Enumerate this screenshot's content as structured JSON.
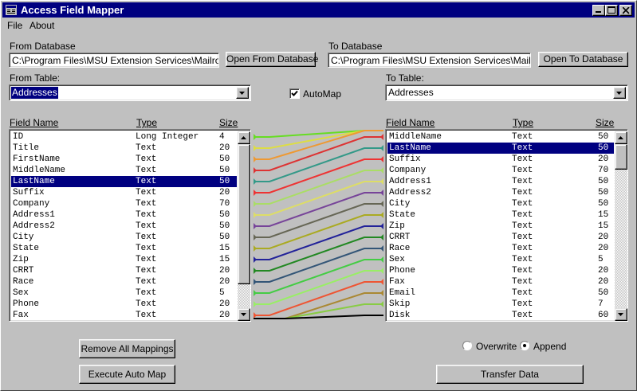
{
  "window": {
    "title": "Access Field Mapper"
  },
  "menu": [
    {
      "label": "File"
    },
    {
      "label": "About"
    }
  ],
  "from_db": {
    "label": "From Database",
    "path": "C:\\Program Files\\MSU Extension Services\\Mailroom\\",
    "button": "Open From Database"
  },
  "to_db": {
    "label": "To Database",
    "path": "C:\\Program Files\\MSU Extension Services\\Mailroom",
    "button": "Open To Database"
  },
  "from_table": {
    "label": "From Table:",
    "value": "Addresses"
  },
  "to_table": {
    "label": "To Table:",
    "value": "Addresses"
  },
  "automap": {
    "label": "AutoMap",
    "checked": true
  },
  "columns": {
    "name": "Field Name",
    "type": "Type",
    "size": "Size"
  },
  "from_fields": [
    {
      "name": "ID",
      "type": "Long Integer",
      "size": "4"
    },
    {
      "name": "Title",
      "type": "Text",
      "size": "20"
    },
    {
      "name": "FirstName",
      "type": "Text",
      "size": "50"
    },
    {
      "name": "MiddleName",
      "type": "Text",
      "size": "50"
    },
    {
      "name": "LastName",
      "type": "Text",
      "size": "50",
      "selected": true
    },
    {
      "name": "Suffix",
      "type": "Text",
      "size": "20"
    },
    {
      "name": "Company",
      "type": "Text",
      "size": "70"
    },
    {
      "name": "Address1",
      "type": "Text",
      "size": "50"
    },
    {
      "name": "Address2",
      "type": "Text",
      "size": "50"
    },
    {
      "name": "City",
      "type": "Text",
      "size": "50"
    },
    {
      "name": "State",
      "type": "Text",
      "size": "15"
    },
    {
      "name": "Zip",
      "type": "Text",
      "size": "15"
    },
    {
      "name": "CRRT",
      "type": "Text",
      "size": "20"
    },
    {
      "name": "Race",
      "type": "Text",
      "size": "20"
    },
    {
      "name": "Sex",
      "type": "Text",
      "size": "5"
    },
    {
      "name": "Phone",
      "type": "Text",
      "size": "20"
    },
    {
      "name": "Fax",
      "type": "Text",
      "size": "20"
    }
  ],
  "to_fields": [
    {
      "name": "MiddleName",
      "type": "Text",
      "size": "50"
    },
    {
      "name": "LastName",
      "type": "Text",
      "size": "50",
      "selected": true
    },
    {
      "name": "Suffix",
      "type": "Text",
      "size": "20"
    },
    {
      "name": "Company",
      "type": "Text",
      "size": "70"
    },
    {
      "name": "Address1",
      "type": "Text",
      "size": "50"
    },
    {
      "name": "Address2",
      "type": "Text",
      "size": "50"
    },
    {
      "name": "City",
      "type": "Text",
      "size": "50"
    },
    {
      "name": "State",
      "type": "Text",
      "size": "15"
    },
    {
      "name": "Zip",
      "type": "Text",
      "size": "15"
    },
    {
      "name": "CRRT",
      "type": "Text",
      "size": "20"
    },
    {
      "name": "Race",
      "type": "Text",
      "size": "20"
    },
    {
      "name": "Sex",
      "type": "Text",
      "size": "5"
    },
    {
      "name": "Phone",
      "type": "Text",
      "size": "20"
    },
    {
      "name": "Fax",
      "type": "Text",
      "size": "20"
    },
    {
      "name": "Email",
      "type": "Text",
      "size": "50"
    },
    {
      "name": "Skip",
      "type": "Text",
      "size": "7"
    },
    {
      "name": "Disk",
      "type": "Text",
      "size": "60"
    }
  ],
  "mappings": [
    {
      "from": 0,
      "to": -1,
      "color": "#66dd22"
    },
    {
      "from": 1,
      "to": -1,
      "color": "#dddd44"
    },
    {
      "from": 2,
      "to": -1,
      "color": "#ee9933"
    },
    {
      "from": 3,
      "to": 0,
      "color": "#dd3333"
    },
    {
      "from": 4,
      "to": 1,
      "color": "#339988"
    },
    {
      "from": 5,
      "to": 2,
      "color": "#ee3333"
    },
    {
      "from": 6,
      "to": 3,
      "color": "#aadd66"
    },
    {
      "from": 7,
      "to": 4,
      "color": "#dddd66"
    },
    {
      "from": 8,
      "to": 5,
      "color": "#774499"
    },
    {
      "from": 9,
      "to": 6,
      "color": "#666655"
    },
    {
      "from": 10,
      "to": 7,
      "color": "#aaaa22"
    },
    {
      "from": 11,
      "to": 8,
      "color": "#222299"
    },
    {
      "from": 12,
      "to": 9,
      "color": "#228822"
    },
    {
      "from": 13,
      "to": 10,
      "color": "#335577"
    },
    {
      "from": 14,
      "to": 11,
      "color": "#44cc44"
    },
    {
      "from": 15,
      "to": 12,
      "color": "#99ee66"
    },
    {
      "from": 16,
      "to": 13,
      "color": "#ee5533"
    },
    {
      "from": 17,
      "to": 14,
      "color": "#aa8833"
    },
    {
      "from": 18,
      "to": 15,
      "color": "#88cc44"
    },
    {
      "from": 18,
      "to": 16,
      "color": "#000000"
    }
  ],
  "buttons": {
    "remove_all": "Remove All Mappings",
    "auto_map": "Execute Auto Map",
    "transfer": "Transfer Data"
  },
  "mode": {
    "overwrite": "Overwrite",
    "append": "Append",
    "selected": "append"
  }
}
